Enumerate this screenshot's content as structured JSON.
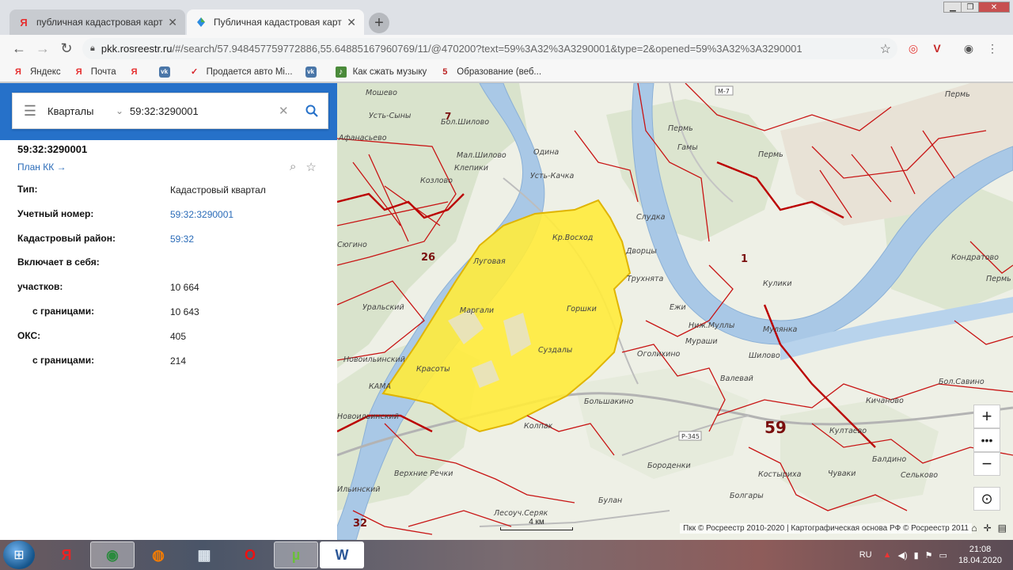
{
  "browser": {
    "tabs": [
      {
        "title": "публичная кадастровая карта –",
        "favicon": "yandex-icon",
        "active": false
      },
      {
        "title": "Публичная кадастровая карта",
        "favicon": "rosreestr-icon",
        "active": true
      }
    ],
    "new_tab_symbol": "+",
    "address": {
      "host": "pkk.rosreestr.ru",
      "path": "/#/search/57.948457759772886,55.64885167960769/11/@470200?text=59%3A32%3A3290001&type=2&opened=59%3A32%3A3290001"
    },
    "bookmarks": [
      {
        "label": "Яндекс",
        "icon": "yandex-icon",
        "color": "#e62e2e",
        "glyph": "Я"
      },
      {
        "label": "Почта",
        "icon": "yandex-mail-icon",
        "color": "#e62e2e",
        "glyph": "Я"
      },
      {
        "label": "",
        "icon": "yandex-icon",
        "color": "#e62e2e",
        "glyph": "Я"
      },
      {
        "label": "",
        "icon": "vk-icon",
        "color": "#4a76a8",
        "glyph": "vk"
      },
      {
        "label": "Продается авто Mi...",
        "icon": "auto-icon",
        "color": "#d8232a",
        "glyph": "✓"
      },
      {
        "label": "",
        "icon": "vk-icon",
        "color": "#4a76a8",
        "glyph": "vk"
      },
      {
        "label": "Как сжать музыку",
        "icon": "music-icon",
        "color": "#4a8a3a",
        "glyph": "♪"
      },
      {
        "label": "Образование (веб...",
        "icon": "education-icon",
        "color": "#b22",
        "glyph": "5"
      }
    ]
  },
  "search": {
    "type_label": "Кварталы",
    "query": "59:32:3290001"
  },
  "info": {
    "title": "59:32:3290001",
    "plan_link": "План КК →",
    "rows": [
      {
        "label": "Тип:",
        "value": "Кадастровый квартал",
        "link": false,
        "indent": false
      },
      {
        "label": "Учетный номер:",
        "value": "59:32:3290001",
        "link": true,
        "indent": false
      },
      {
        "label": "Кадастровый район:",
        "value": "59:32",
        "link": true,
        "indent": false
      },
      {
        "label": "Включает в себя:",
        "value": "",
        "link": false,
        "indent": false
      },
      {
        "label": "участков:",
        "value": "10 664",
        "link": false,
        "indent": false
      },
      {
        "label": "с границами:",
        "value": "10 643",
        "link": false,
        "indent": true
      },
      {
        "label": "ОКС:",
        "value": "405",
        "link": false,
        "indent": false
      },
      {
        "label": "с границами:",
        "value": "214",
        "link": false,
        "indent": true
      }
    ]
  },
  "map": {
    "place_labels": {
      "moshevo": "Мошево",
      "ust_syny": "Усть-Сыны",
      "bol_shilovo": "Бол.Шилово",
      "afanasyevo": "Афанасьево",
      "mal_shilovo": "Мал.Шилово",
      "klepiki": "Клепики",
      "odina": "Одина",
      "ust_kachka": "Усть-Качка",
      "kozlovo": "Козлово",
      "perm_a": "Пермь",
      "perm_b": "Пермь",
      "perm_c": "Пермь",
      "perm_d": "Пермь",
      "gamy": "Гамы",
      "kr_voskhod": "Кр.Восход",
      "sludka": "Слудка",
      "lugovaya": "Луговая",
      "dvortsy": "Дворцы",
      "trukhnyata": "Трухнята",
      "kuliki": "Кулики",
      "kondratovo": "Кондратово",
      "margali": "Маргали",
      "gorshki": "Горшки",
      "ezhi": "Ежи",
      "nizh_muly": "Ниж.Муллы",
      "mulyanka": "Мулянка",
      "murashi": "Мураши",
      "suzdaly": "Суздалы",
      "ogolikhino": "Оголихино",
      "shilovo": "Шилово",
      "krasoty": "Красоты",
      "valevai": "Валевай",
      "bol_savino": "Бол.Савино",
      "uralskiy": "Уральский",
      "novoilinskiy_a": "Новоильинский",
      "novoilinskiy_b": "Новоильинский",
      "bolshakino": "Большакино",
      "kichanovo": "Кичаново",
      "kultaevo": "Култаево",
      "baldino": "Балдино",
      "borodenki": "Бороденки",
      "kostyrikha": "Костыриха",
      "chuvaki": "Чуваки",
      "selkovo": "Сельково",
      "verkhnie_rechki": "Верхние Речки",
      "bulgary": "Болгары",
      "bulan": "Булан",
      "lesouch": "Лесоуч.Серяк",
      "sergino": "Сюгино",
      "ilinskiy": "Ильинский",
      "kolpak": "Колпак",
      "kama": "КАМА"
    },
    "district_numbers": {
      "d7": "7",
      "d26": "26",
      "d1": "1",
      "d59": "59",
      "d32": "32"
    },
    "roads": {
      "m7": "М-7",
      "r345": "Р-345"
    },
    "scale_label": "4 км",
    "attribution": "Пкк © Росреестр 2010-2020 | Картографическая основа РФ © Росреестр 2011",
    "highlight_color": "#ffeb3b",
    "boundary_color": "#c81414"
  },
  "taskbar": {
    "apps": [
      {
        "name": "yandex-browser-icon",
        "glyph": "Я",
        "color": "#e22",
        "active": false
      },
      {
        "name": "chrome-icon",
        "glyph": "◉",
        "color": "#2b8a3e",
        "active": true
      },
      {
        "name": "firefox-icon",
        "glyph": "◍",
        "color": "#f57c00",
        "active": false
      },
      {
        "name": "calculator-icon",
        "glyph": "▦",
        "color": "#dfe8f0",
        "active": false
      },
      {
        "name": "opera-icon",
        "glyph": "O",
        "color": "#e11",
        "active": false
      },
      {
        "name": "utorrent-icon",
        "glyph": "µ",
        "color": "#6bbf3b",
        "active": true
      },
      {
        "name": "word-icon",
        "glyph": "W",
        "color": "#2b5797",
        "active": true
      }
    ],
    "language": "RU",
    "time": "21:08",
    "date": "18.04.2020"
  }
}
